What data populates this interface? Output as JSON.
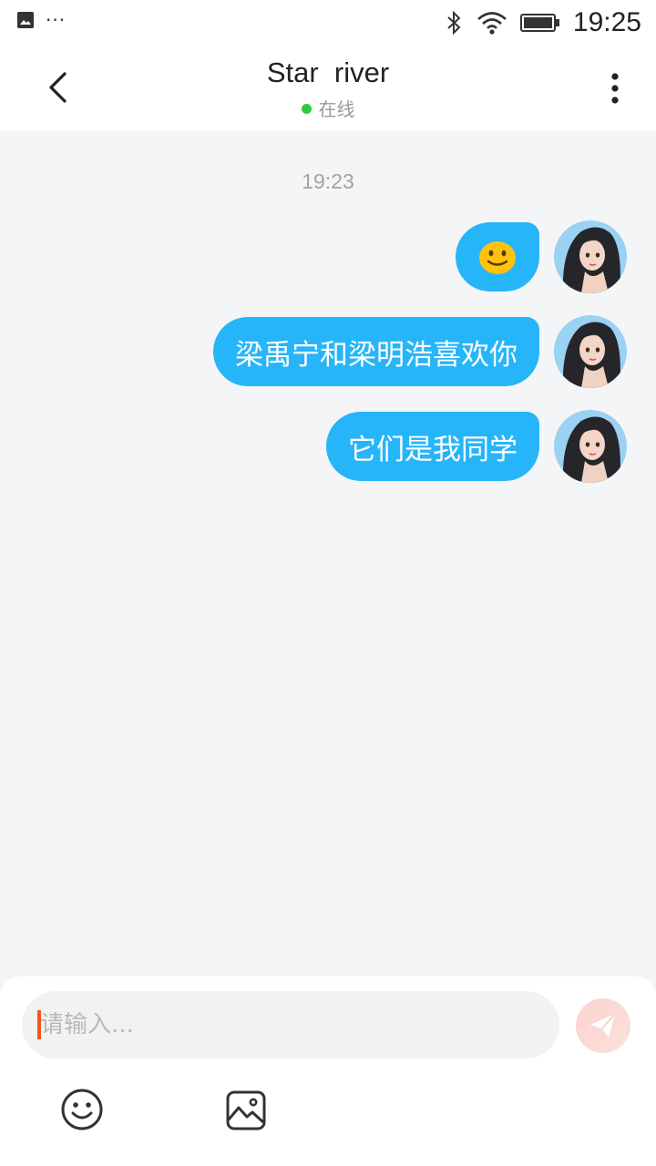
{
  "status_bar": {
    "time": "19:25",
    "icons": [
      "image-notification-icon",
      "more-notifications-icon",
      "bluetooth-icon",
      "wifi-icon",
      "battery-icon"
    ]
  },
  "header": {
    "title": "Star  river",
    "status": "在线",
    "status_color": "#2ecc40"
  },
  "chat": {
    "timestamp": "19:23",
    "bubble_color": "#27b5f9",
    "messages": [
      {
        "type": "emoji",
        "content": "slightly-smiling-face-emoji",
        "sender": "me"
      },
      {
        "type": "text",
        "content": "梁禹宁和梁明浩喜欢你",
        "sender": "me"
      },
      {
        "type": "text",
        "content": "它们是我同学",
        "sender": "me"
      }
    ]
  },
  "composer": {
    "placeholder": "请输入...",
    "value": "",
    "send_icon": "paper-plane-icon",
    "tools": [
      "emoji-face-icon",
      "image-picker-icon"
    ]
  }
}
